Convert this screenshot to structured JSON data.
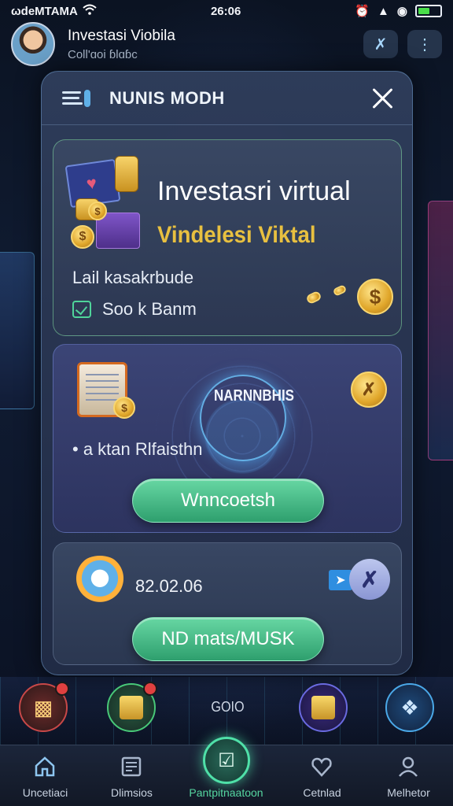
{
  "status_bar": {
    "carrier": "ωdeΜTAMA",
    "time": "26:06"
  },
  "header": {
    "title": "Investasi Viobila",
    "subtitle": "Coll'ɑoi ɓlɑɓc"
  },
  "modal": {
    "title": "NUNIS MODH",
    "card1": {
      "title": "Investasri virtual",
      "subtitle": "Vindelesi Viktal",
      "line1": "Lail kasakrbude",
      "check_label": "Soo k Banm"
    },
    "card2": {
      "core_label": "NARNNBHIS",
      "bullet": "• a ktan Rlfaisthn",
      "button": "Wnncoetsh"
    },
    "card3": {
      "value": "82.02.06",
      "button": "ND mats/MUSK"
    }
  },
  "quick_actions": {
    "center_label": "GOIO"
  },
  "bottom_nav": [
    {
      "label": "Uncetiaci",
      "icon": "home-icon"
    },
    {
      "label": "Dlimsios",
      "icon": "news-icon"
    },
    {
      "label": "Pantpitnaatoon",
      "icon": "invest-icon"
    },
    {
      "label": "Cetnlad",
      "icon": "heart-icon"
    },
    {
      "label": "Melhetor",
      "icon": "user-icon"
    }
  ],
  "colors": {
    "accent_green": "#4fe0a8",
    "gold": "#e8c040",
    "background": "#0c1424"
  }
}
